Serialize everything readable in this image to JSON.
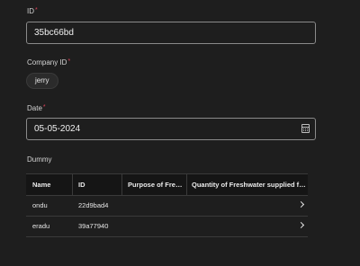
{
  "form": {
    "id": {
      "label": "ID",
      "value": "35bc66bd"
    },
    "company_id": {
      "label": "Company ID",
      "chip": "jerry"
    },
    "date": {
      "label": "Date",
      "value": "05-05-2024"
    },
    "dummy": {
      "label": "Dummy"
    }
  },
  "table": {
    "columns": [
      "Name",
      "ID",
      "Purpose of Fresh…",
      "Quantity of Freshwater supplied for …"
    ],
    "rows": [
      {
        "name": "ondu",
        "id": "22d9bad4"
      },
      {
        "name": "eradu",
        "id": "39a77940"
      }
    ]
  },
  "icons": {
    "date_picker": "calendar-icon",
    "row_open": "chevron-right-icon"
  },
  "colors": {
    "required": "#e0435b",
    "background": "#1e1e1e"
  }
}
